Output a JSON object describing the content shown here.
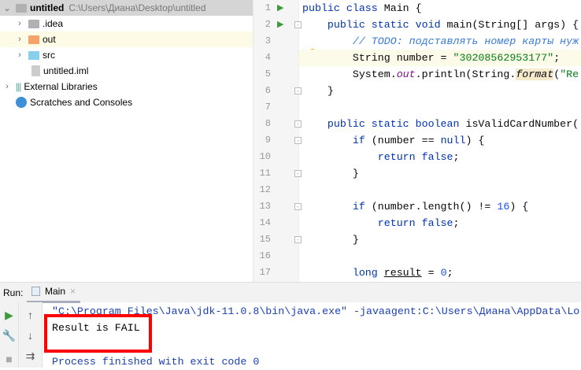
{
  "project": {
    "root": {
      "name": "untitled",
      "path": "C:\\Users\\Диана\\Desktop\\untitled"
    },
    "items": [
      {
        "label": ".idea",
        "color": "#afb1b3"
      },
      {
        "label": "out",
        "color": "#f4a46b"
      },
      {
        "label": "src",
        "color": "#87cfea"
      },
      {
        "label": "untitled.iml"
      }
    ],
    "external": "External Libraries",
    "scratches": "Scratches and Consoles"
  },
  "editor": {
    "line_numbers": [
      "1",
      "2",
      "3",
      "4",
      "5",
      "6",
      "7",
      "8",
      "9",
      "10",
      "11",
      "12",
      "13",
      "14",
      "15",
      "16",
      "17"
    ],
    "lines": [
      [
        {
          "t": "public class ",
          "c": "kw"
        },
        {
          "t": "Main {",
          "c": ""
        }
      ],
      [
        {
          "t": "    public static void ",
          "c": "kw"
        },
        {
          "t": "main(String[] args) {",
          "c": ""
        }
      ],
      [
        {
          "t": "        // TODO: подставлять номер карты нуж",
          "c": "cm"
        }
      ],
      [
        {
          "t": "        String number = ",
          "c": ""
        },
        {
          "t": "\"30208562953177\"",
          "c": "str"
        },
        {
          "t": ";",
          "c": ""
        }
      ],
      [
        {
          "t": "        System.",
          "c": ""
        },
        {
          "t": "out",
          "c": "st"
        },
        {
          "t": ".println(String.",
          "c": ""
        },
        {
          "t": "format",
          "c": "it"
        },
        {
          "t": "(",
          "c": ""
        },
        {
          "t": "\"Re",
          "c": "str"
        }
      ],
      [
        {
          "t": "    }",
          "c": ""
        }
      ],
      [],
      [
        {
          "t": "    public static boolean ",
          "c": "kw"
        },
        {
          "t": "isValidCardNumber(",
          "c": ""
        }
      ],
      [
        {
          "t": "        if ",
          "c": "kw"
        },
        {
          "t": "(number == ",
          "c": ""
        },
        {
          "t": "null",
          "c": "kw"
        },
        {
          "t": ") {",
          "c": ""
        }
      ],
      [
        {
          "t": "            return false",
          "c": "kw"
        },
        {
          "t": ";",
          "c": ""
        }
      ],
      [
        {
          "t": "        }",
          "c": ""
        }
      ],
      [],
      [
        {
          "t": "        if ",
          "c": "kw"
        },
        {
          "t": "(number.length() != ",
          "c": ""
        },
        {
          "t": "16",
          "c": "num"
        },
        {
          "t": ") {",
          "c": ""
        }
      ],
      [
        {
          "t": "            return false",
          "c": "kw"
        },
        {
          "t": ";",
          "c": ""
        }
      ],
      [
        {
          "t": "        }",
          "c": ""
        }
      ],
      [],
      [
        {
          "t": "        long ",
          "c": "kw"
        },
        {
          "t": "result",
          "c": "ul"
        },
        {
          "t": " = ",
          "c": ""
        },
        {
          "t": "0",
          "c": "num"
        },
        {
          "t": ";",
          "c": ""
        }
      ]
    ]
  },
  "run": {
    "label": "Run:",
    "tab": "Main",
    "console": [
      "\"C:\\Program Files\\Java\\jdk-11.0.8\\bin\\java.exe\" -javaagent:C:\\Users\\Диана\\AppData\\Lo",
      "Result is FAIL",
      "",
      "Process finished with exit code 0"
    ]
  }
}
